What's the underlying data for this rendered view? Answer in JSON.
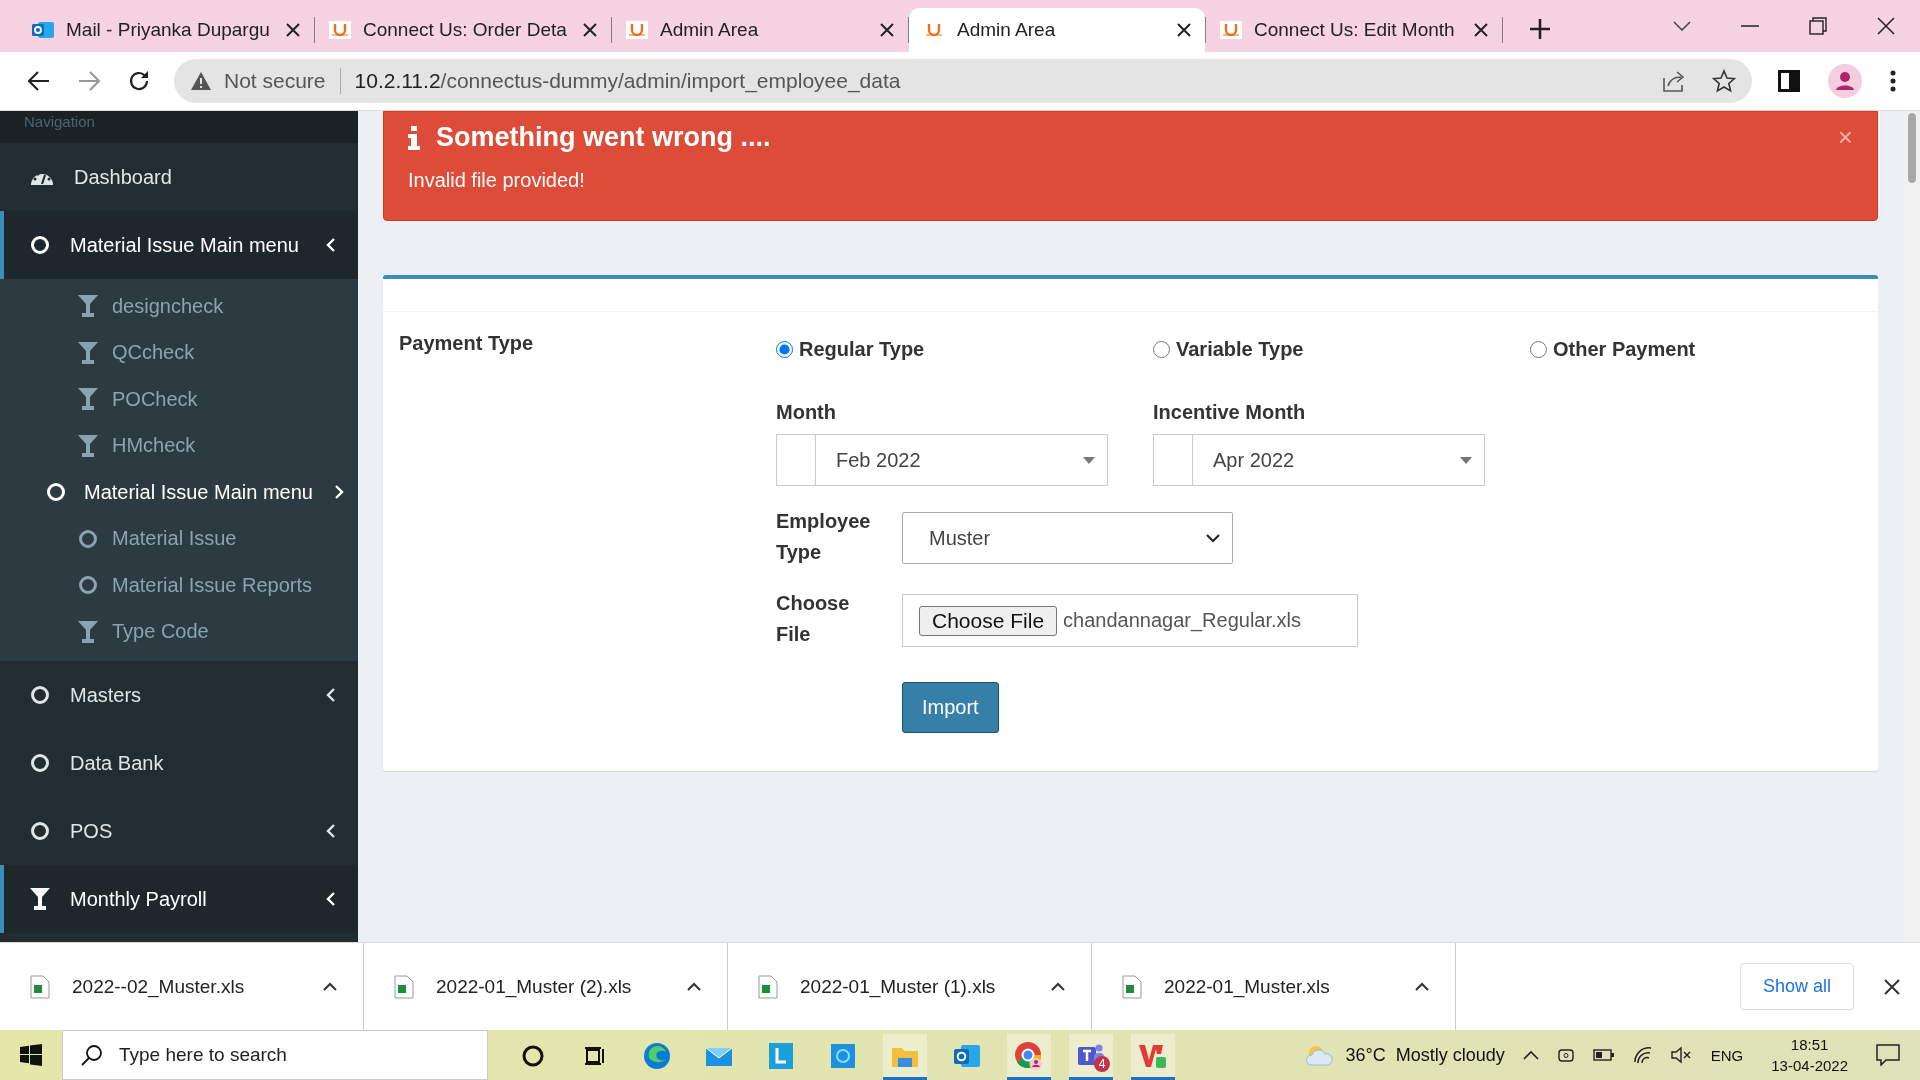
{
  "browser": {
    "tabs": [
      {
        "title": "Mail - Priyanka Dupargu",
        "kind": "outlook",
        "selected": false
      },
      {
        "title": "Connect Us: Order Deta",
        "kind": "site",
        "selected": false
      },
      {
        "title": "Admin Area",
        "kind": "site",
        "selected": false
      },
      {
        "title": "Admin Area",
        "kind": "site",
        "selected": true
      },
      {
        "title": "Connect Us: Edit Month",
        "kind": "site",
        "selected": false
      }
    ],
    "security": "Not secure",
    "url_host": "10.2.11.2",
    "url_path": "/connectus-dummy/admin/import_employee_data"
  },
  "sidebar": {
    "header": "Navigation",
    "items": [
      {
        "label": "Dashboard",
        "kind": "dashboard",
        "active": false,
        "chevron": false
      },
      {
        "label": "Material Issue Main menu",
        "kind": "circle",
        "active": true,
        "chevron": true,
        "children": [
          {
            "label": "designcheck",
            "kind": "filter",
            "chevron": false
          },
          {
            "label": "QCcheck",
            "kind": "filter",
            "chevron": false
          },
          {
            "label": "POCheck",
            "kind": "filter",
            "chevron": false
          },
          {
            "label": "HMcheck",
            "kind": "filter",
            "chevron": false
          },
          {
            "label": "Material Issue Main menu",
            "kind": "submenu",
            "chevron": true,
            "children": [
              {
                "label": "Material Issue",
                "kind": "circle",
                "chevron": false
              },
              {
                "label": "Material Issue Reports",
                "kind": "circle",
                "chevron": false
              }
            ]
          },
          {
            "label": "Type Code",
            "kind": "filter",
            "chevron": false
          }
        ]
      },
      {
        "label": "Masters",
        "kind": "circle",
        "active": false,
        "chevron": true
      },
      {
        "label": "Data Bank",
        "kind": "circle",
        "active": false,
        "chevron": false
      },
      {
        "label": "POS",
        "kind": "circle",
        "active": false,
        "chevron": true
      },
      {
        "label": "Monthly Payroll",
        "kind": "filter",
        "active": true,
        "chevron": true
      }
    ]
  },
  "alert": {
    "title": "Something went wrong ....",
    "message": "Invalid file provided!",
    "close": "×"
  },
  "form": {
    "payment_type": {
      "label": "Payment Type",
      "options": [
        {
          "label": "Regular Type",
          "selected": true
        },
        {
          "label": "Variable Type",
          "selected": false
        },
        {
          "label": "Other Payment",
          "selected": false
        }
      ]
    },
    "month": {
      "label": "Month",
      "value": "Feb 2022"
    },
    "incentive_month": {
      "label": "Incentive Month",
      "value": "Apr 2022"
    },
    "employee_type": {
      "label": "Employee Type",
      "value": "Muster"
    },
    "file": {
      "label": "Choose File",
      "button": "Choose File",
      "value": "chandannagar_Regular.xls"
    },
    "import_button": "Import"
  },
  "downloads": {
    "items": [
      {
        "name": "2022--02_Muster.xls"
      },
      {
        "name": "2022-01_Muster (2).xls"
      },
      {
        "name": "2022-01_Muster (1).xls"
      },
      {
        "name": "2022-01_Muster.xls"
      }
    ],
    "show_all": "Show all"
  },
  "taskbar": {
    "search_placeholder": "Type here to search",
    "apps": [
      {
        "kind": "cortana",
        "running": false
      },
      {
        "kind": "taskview",
        "running": false
      },
      {
        "kind": "edge",
        "running": false
      },
      {
        "kind": "mail",
        "running": false
      },
      {
        "kind": "l-app",
        "running": false
      },
      {
        "kind": "alexa",
        "running": false
      },
      {
        "kind": "explorer",
        "running": true
      },
      {
        "kind": "outlook",
        "running": false
      },
      {
        "kind": "chrome",
        "running": true
      },
      {
        "kind": "teams",
        "running": true,
        "badge": "4"
      },
      {
        "kind": "wps",
        "running": true
      }
    ],
    "weather": {
      "temp": "36°C",
      "text": "Mostly cloudy"
    },
    "language": "ENG",
    "time": "18:51",
    "date": "13-04-2022"
  }
}
